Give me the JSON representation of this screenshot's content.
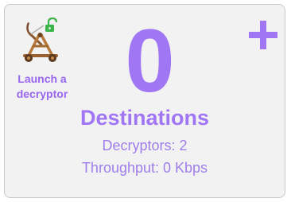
{
  "card": {
    "count": "0",
    "title": "Destinations",
    "decryptors_text": "Decryptors: 2",
    "throughput_text": "Throughput: 0 Kbps"
  },
  "launch": {
    "label": "Launch a decryptor",
    "icon": "catapult-icon",
    "badge_icon": "unlock-icon"
  },
  "add_button": {
    "icon": "plus-icon"
  },
  "colors": {
    "accent": "#a076f4",
    "label": "#9966f0",
    "card_bg": "#f2f2f2",
    "lock": "#3bb54a"
  }
}
